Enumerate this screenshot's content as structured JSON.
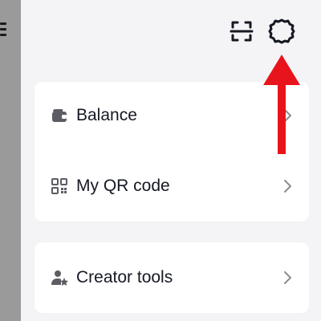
{
  "header": {
    "icons": [
      "menu-icon",
      "scan-icon",
      "settings-icon"
    ]
  },
  "menu_card_1": {
    "items": [
      {
        "label": "Balance",
        "icon": "wallet-icon"
      },
      {
        "label": "My QR code",
        "icon": "qr-code-icon"
      }
    ]
  },
  "menu_card_2": {
    "items": [
      {
        "label": "Creator tools",
        "icon": "creator-tools-icon"
      }
    ]
  },
  "annotation": {
    "arrow_color": "#e8141b",
    "points_to": "settings-icon"
  },
  "colors": {
    "background": "#f4f4f6",
    "card": "#ffffff",
    "text": "#161823",
    "chevron": "#8a8b91",
    "side_strip": "#9a9a9a"
  }
}
